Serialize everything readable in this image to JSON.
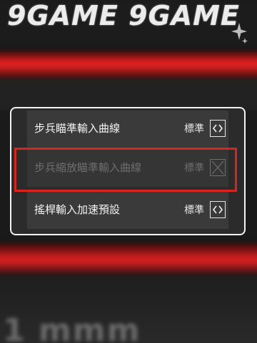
{
  "watermark": {
    "text": "9GAME 9GAME"
  },
  "background": {
    "text": "1 mmm"
  },
  "settings": {
    "rows": [
      {
        "label": "步兵瞄準輸入曲線",
        "value": "標準",
        "disabled": false
      },
      {
        "label": "步兵縮放瞄準輸入曲線",
        "value": "標準",
        "disabled": true
      },
      {
        "label": "搖桿輸入加速預設",
        "value": "標準",
        "disabled": false
      }
    ]
  },
  "colors": {
    "highlight": "#d9251d",
    "panel_border": "#f2f2f2",
    "accent_red": "#e02222"
  },
  "icons": {
    "stepper": "left-right-arrows-icon",
    "stepper_disabled": "crossed-box-icon",
    "sparkle": "sparkle-icon"
  }
}
